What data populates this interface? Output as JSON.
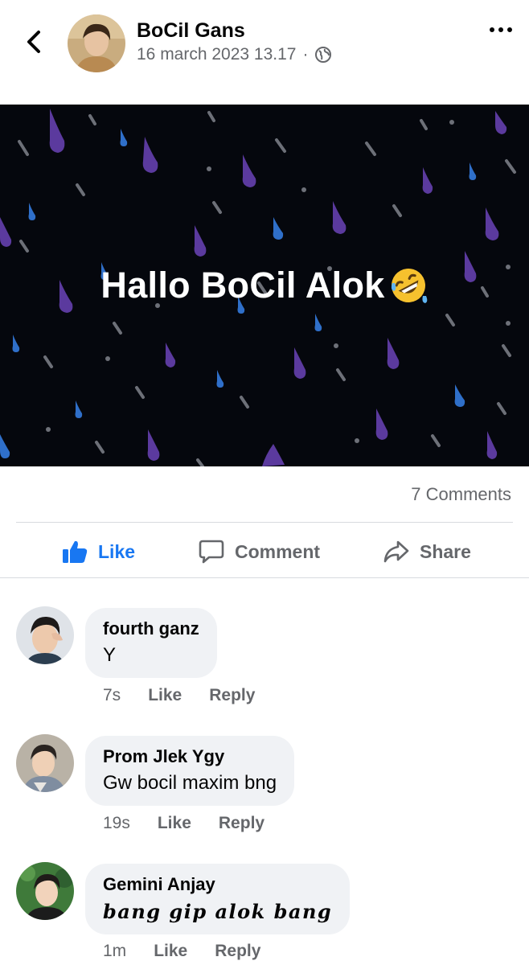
{
  "post": {
    "author": "BoCil Gans",
    "timestamp": "16 march 2023 13.17",
    "separator": "·",
    "privacy_icon": "globe-icon",
    "banner_text": "Hallo BoCil Alok",
    "banner_emoji": "rolling-on-floor-laughing-emoji",
    "comment_count": "7 Comments"
  },
  "actions": {
    "like": "Like",
    "comment": "Comment",
    "share": "Share"
  },
  "comments": [
    {
      "name": "fourth ganz",
      "text": "Y",
      "time": "7s",
      "like": "Like",
      "reply": "Reply"
    },
    {
      "name": "Prom Jlek Ygy",
      "text": "Gw bocil maxim bng",
      "time": "19s",
      "like": "Like",
      "reply": "Reply"
    },
    {
      "name": "Gemini Anjay",
      "text": "bang gip alok bang",
      "time": "1m",
      "like": "Like",
      "reply": "Reply"
    }
  ],
  "colors": {
    "accent": "#1877f2",
    "secondary_text": "#65676b",
    "bubble": "#f0f2f5",
    "banner_bg": "#05070d"
  }
}
